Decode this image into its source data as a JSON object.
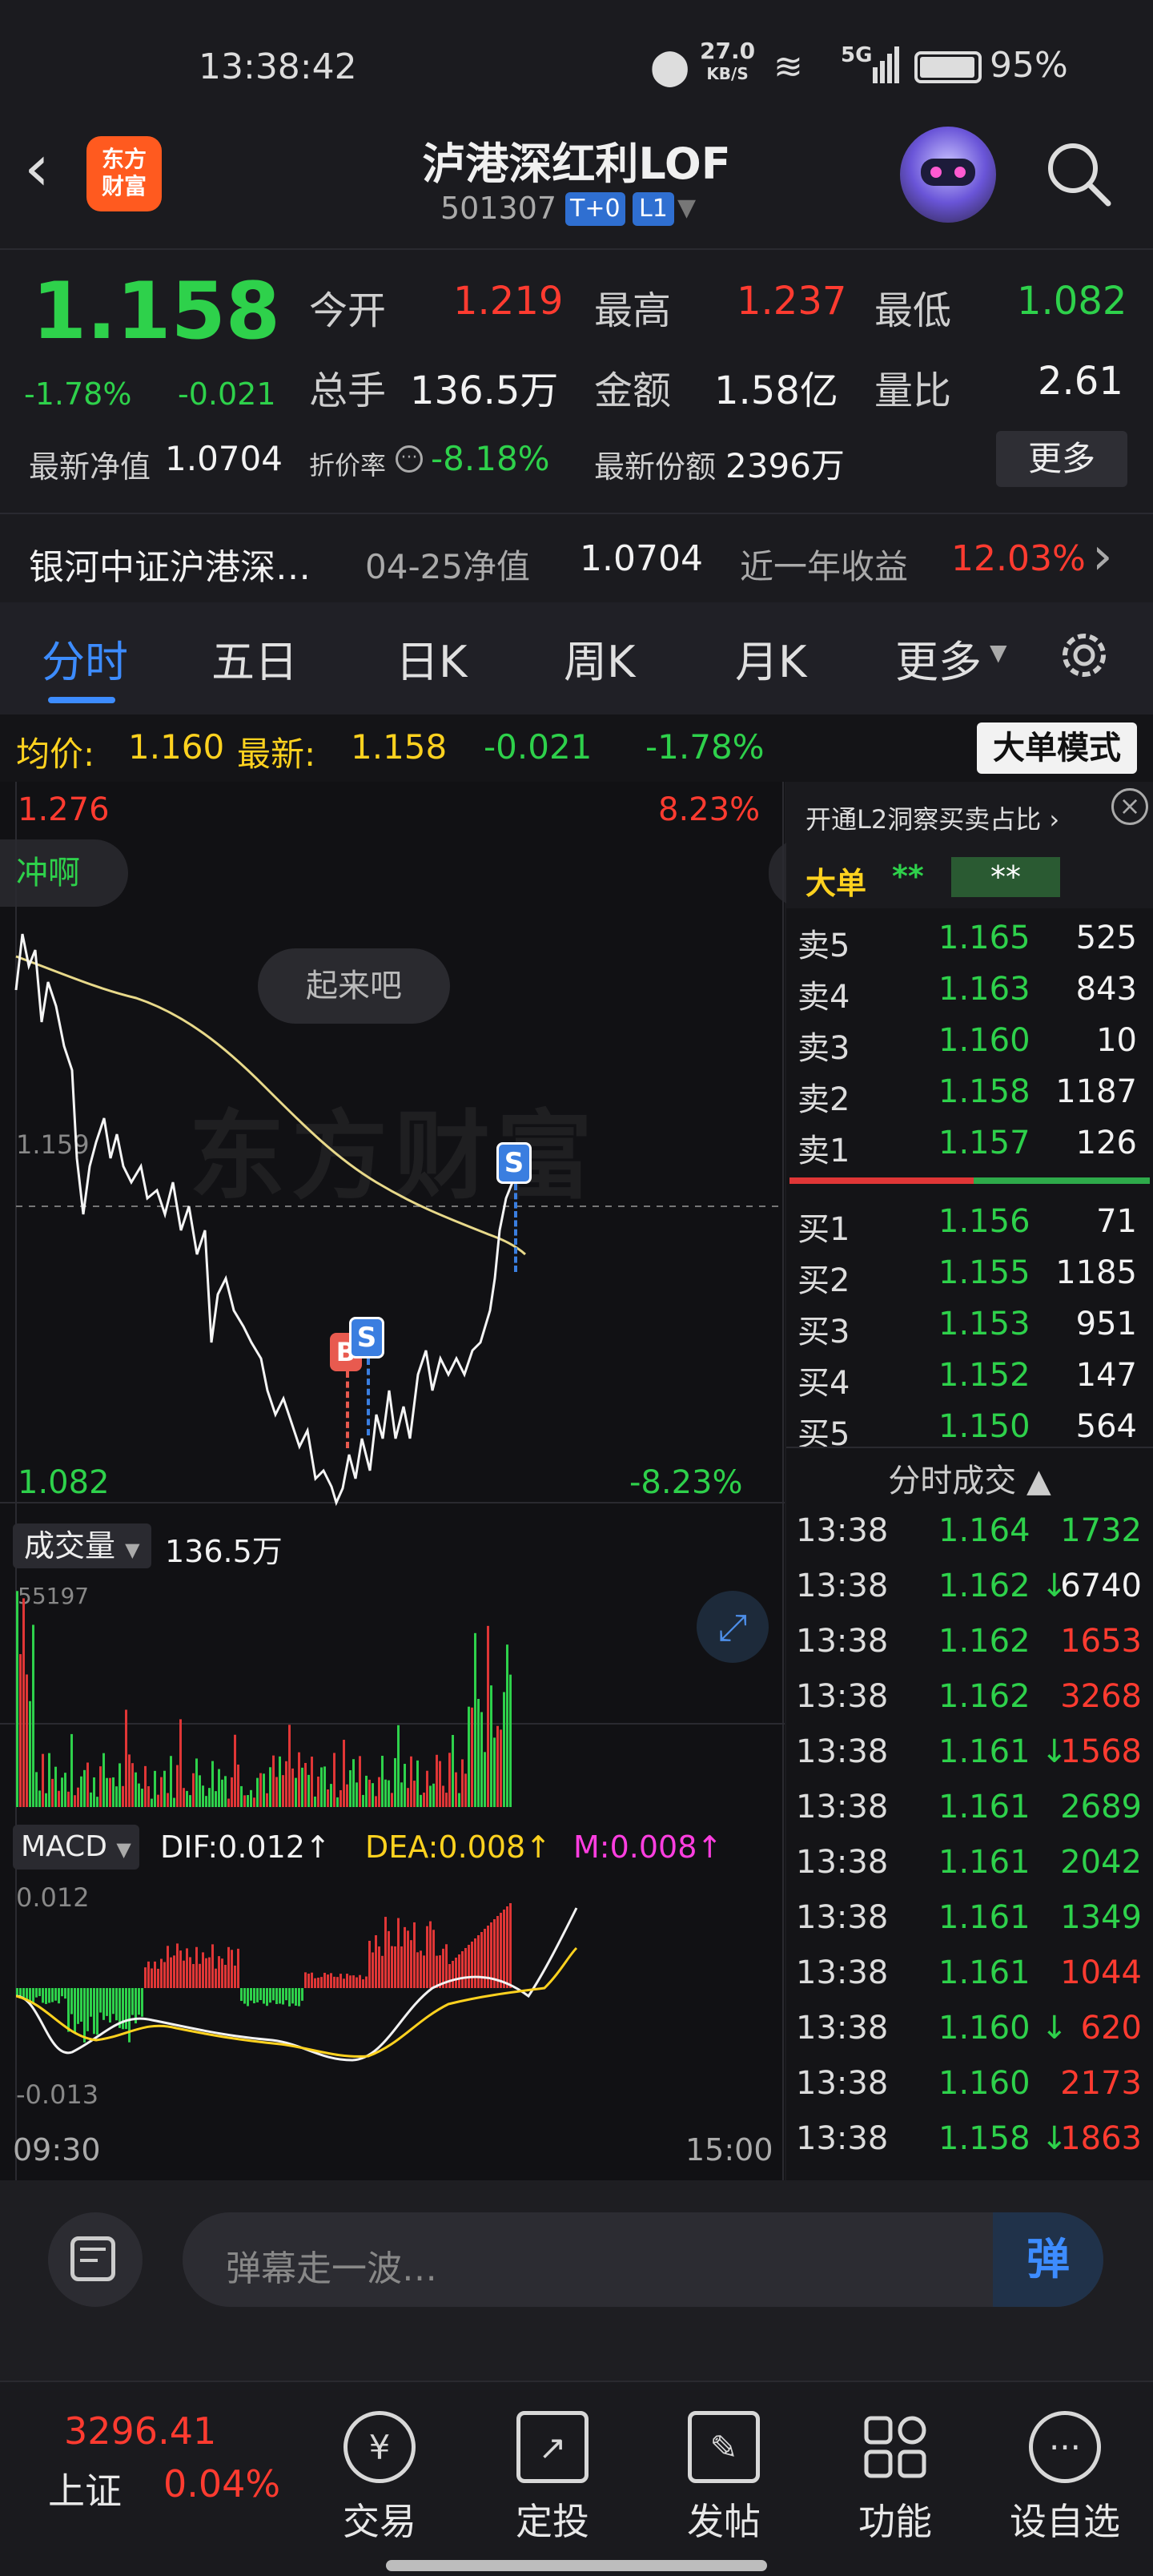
{
  "status": {
    "time": "13:38:42",
    "speed_value": "27.0",
    "speed_unit": "KB/S",
    "network": "5G",
    "battery": "95%"
  },
  "header": {
    "title": "泸港深红利LOF",
    "code": "501307",
    "badge_t0": "T+0",
    "badge_l1": "L1",
    "logo_text_1": "东方",
    "logo_text_2": "财富"
  },
  "quote": {
    "price": "1.158",
    "change_pct": "-1.78%",
    "change": "-0.021",
    "open_label": "今开",
    "open": "1.219",
    "high_label": "最高",
    "high": "1.237",
    "low_label": "最低",
    "low": "1.082",
    "volume_label": "总手",
    "volume": "136.5万",
    "amount_label": "金额",
    "amount": "1.58亿",
    "ratio_label": "量比",
    "ratio": "2.61",
    "nav_label": "最新净值",
    "nav": "1.0704",
    "discount_label": "折价率",
    "discount": "-8.18%",
    "shares_label": "最新份额",
    "shares": "2396万",
    "more_button": "更多"
  },
  "fund": {
    "name": "银河中证沪港深…",
    "nav_date_label": "04-25净值",
    "nav": "1.0704",
    "return_label": "近一年收益",
    "return": "12.03%"
  },
  "tabs": [
    "分时",
    "五日",
    "日K",
    "周K",
    "月K",
    "更多"
  ],
  "chart_header": {
    "avg_label": "均价:",
    "avg": "1.160",
    "last_label": "最新:",
    "last": "1.158",
    "chg": "-0.021",
    "chg_pct": "-1.78%",
    "big_mode": "大单模式"
  },
  "chart_labels": {
    "top_price": "1.276",
    "top_pct": "8.23%",
    "bottom_price": "1.082",
    "bottom_pct": "-8.23%",
    "mid_price": "1.159",
    "bubble_left": "冲啊",
    "bubble_center": "起来吧",
    "watermark": "东方财富",
    "marker_b": "B",
    "marker_s": "S"
  },
  "volume_panel": {
    "label": "成交量",
    "total": "136.5万",
    "max": "55197"
  },
  "macd_panel": {
    "label": "MACD",
    "dif": "DIF:0.012",
    "dea": "DEA:0.008",
    "m": "M:0.008",
    "top": "0.012",
    "bottom": "-0.013",
    "time_start": "09:30",
    "time_end": "15:00"
  },
  "side_header": {
    "l2_text": "开通L2洞察买卖占比",
    "big_order": "大单",
    "stars1": "**",
    "stars2": "**"
  },
  "asks": [
    {
      "label": "卖5",
      "price": "1.165",
      "vol": "525"
    },
    {
      "label": "卖4",
      "price": "1.163",
      "vol": "843"
    },
    {
      "label": "卖3",
      "price": "1.160",
      "vol": "10"
    },
    {
      "label": "卖2",
      "price": "1.158",
      "vol": "1187"
    },
    {
      "label": "卖1",
      "price": "1.157",
      "vol": "126"
    }
  ],
  "bids": [
    {
      "label": "买1",
      "price": "1.156",
      "vol": "71"
    },
    {
      "label": "买2",
      "price": "1.155",
      "vol": "1185"
    },
    {
      "label": "买3",
      "price": "1.153",
      "vol": "951"
    },
    {
      "label": "买4",
      "price": "1.152",
      "vol": "147"
    },
    {
      "label": "买5",
      "price": "1.150",
      "vol": "564"
    }
  ],
  "trades_title": "分时成交",
  "trades": [
    {
      "time": "13:38",
      "price": "1.164",
      "arrow": "",
      "vol": "1732",
      "color": "green"
    },
    {
      "time": "13:38",
      "price": "1.162",
      "arrow": "↓",
      "vol": "6740",
      "color": "white"
    },
    {
      "time": "13:38",
      "price": "1.162",
      "arrow": "",
      "vol": "1653",
      "color": "red"
    },
    {
      "time": "13:38",
      "price": "1.162",
      "arrow": "",
      "vol": "3268",
      "color": "red"
    },
    {
      "time": "13:38",
      "price": "1.161",
      "arrow": "↓",
      "vol": "1568",
      "color": "red"
    },
    {
      "time": "13:38",
      "price": "1.161",
      "arrow": "",
      "vol": "2689",
      "color": "green"
    },
    {
      "time": "13:38",
      "price": "1.161",
      "arrow": "",
      "vol": "2042",
      "color": "green"
    },
    {
      "time": "13:38",
      "price": "1.161",
      "arrow": "",
      "vol": "1349",
      "color": "green"
    },
    {
      "time": "13:38",
      "price": "1.161",
      "arrow": "",
      "vol": "1044",
      "color": "red"
    },
    {
      "time": "13:38",
      "price": "1.160",
      "arrow": "↓",
      "vol": "620",
      "color": "red"
    },
    {
      "time": "13:38",
      "price": "1.160",
      "arrow": "",
      "vol": "2173",
      "color": "red"
    },
    {
      "time": "13:38",
      "price": "1.158",
      "arrow": "↓",
      "vol": "1863",
      "color": "red"
    }
  ],
  "comment_placeholder": "弹幕走一波…",
  "danmu_button": "弹",
  "index": {
    "value": "3296.41",
    "name": "上证",
    "pct": "0.04%"
  },
  "nav": [
    "交易",
    "定投",
    "发帖",
    "功能",
    "设自选"
  ],
  "colors": {
    "up": "#ff3b30",
    "down": "#2ed14b",
    "accent": "#3d8cff",
    "avg_line": "#e8d98a"
  }
}
